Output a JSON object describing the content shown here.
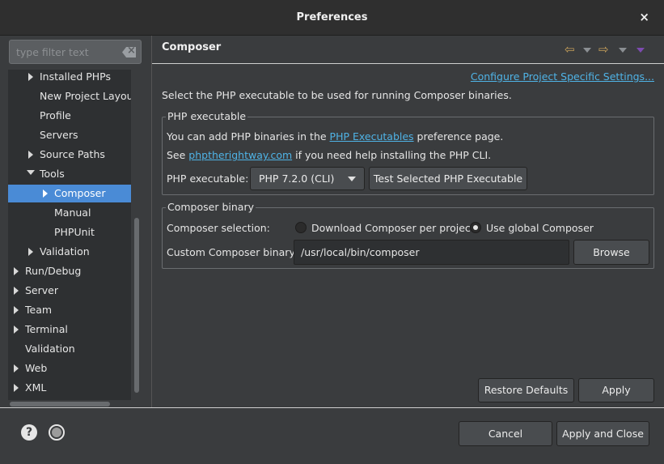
{
  "window": {
    "title": "Preferences",
    "close_label": "×"
  },
  "sidebar": {
    "filter_placeholder": "type filter text",
    "items": [
      {
        "label": "Installed PHPs",
        "expander": "collapsed"
      },
      {
        "label": "New Project Layout",
        "expander": "none"
      },
      {
        "label": "Profile",
        "expander": "none"
      },
      {
        "label": "Servers",
        "expander": "none"
      },
      {
        "label": "Source Paths",
        "expander": "collapsed"
      },
      {
        "label": "Tools",
        "expander": "expanded"
      },
      {
        "label": "Composer",
        "expander": "collapsed",
        "selected": true
      },
      {
        "label": "Manual",
        "expander": "none"
      },
      {
        "label": "PHPUnit",
        "expander": "none"
      },
      {
        "label": "Validation",
        "expander": "collapsed"
      },
      {
        "label": "Run/Debug",
        "expander": "collapsed"
      },
      {
        "label": "Server",
        "expander": "collapsed"
      },
      {
        "label": "Team",
        "expander": "collapsed"
      },
      {
        "label": "Terminal",
        "expander": "collapsed"
      },
      {
        "label": "Validation",
        "expander": "none"
      },
      {
        "label": "Web",
        "expander": "collapsed"
      },
      {
        "label": "XML",
        "expander": "collapsed"
      }
    ]
  },
  "page": {
    "title": "Composer",
    "config_link": "Configure Project Specific Settings...",
    "description": "Select the PHP executable to be used for running Composer binaries.",
    "php_group": {
      "title": "PHP executable",
      "line1_prefix": "You can add PHP binaries in the ",
      "line1_link": "PHP Executables",
      "line1_suffix": " preference page.",
      "line2_prefix": "See ",
      "line2_link": "phptherightway.com",
      "line2_suffix": " if you need help installing the PHP CLI.",
      "executable_label": "PHP executable:",
      "executable_value": "PHP 7.2.0 (CLI)",
      "test_button": "Test Selected PHP Executable"
    },
    "composer_group": {
      "title": "Composer binary",
      "selection_label": "Composer selection:",
      "option_download": "Download Composer per project",
      "option_global": "Use global Composer",
      "selected_option": "Use global Composer",
      "binary_label": "Custom Composer binary:",
      "binary_value": "/usr/local/bin/composer",
      "browse_button": "Browse"
    },
    "restore_defaults": "Restore Defaults",
    "apply": "Apply"
  },
  "footer": {
    "cancel": "Cancel",
    "apply_close": "Apply and Close"
  },
  "colors": {
    "selection": "#4a8bd6",
    "link": "#4fb3e6",
    "nav_arrow": "#c8a15a",
    "menu_arrow": "#7d4bb0"
  },
  "icons": [
    "close-icon",
    "clear-filter-icon",
    "back-arrow-icon",
    "forward-arrow-icon",
    "view-menu-icon",
    "help-icon",
    "preferences-icon"
  ]
}
